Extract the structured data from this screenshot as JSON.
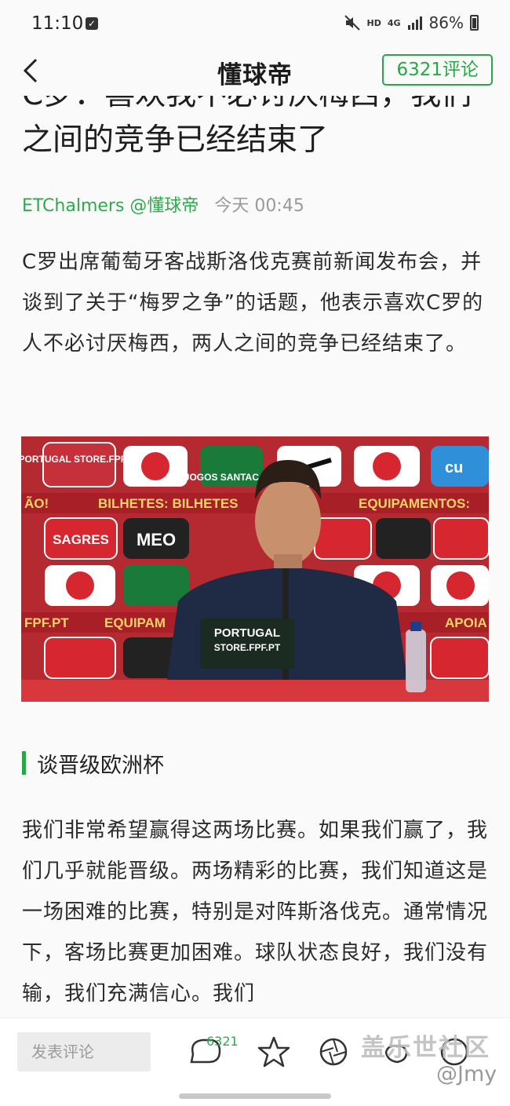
{
  "status_bar": {
    "time": "11:10",
    "network": "HD",
    "network_gen": "4G",
    "battery": "86%"
  },
  "header": {
    "logo": "懂球帝",
    "comment_button": "6321评论"
  },
  "article": {
    "title": "C罗：喜欢我不必讨厌梅西，我们之间的竞争已经结束了",
    "author": "ETChalmers @懂球帝",
    "time": "今天 00:45",
    "intro": "C罗出席葡萄牙客战斯洛伐克赛前新闻发布会，并谈到了关于“梅罗之争”的话题，他表示喜欢C罗的人不必讨厌梅西，两人之间的竞争已经结束了。",
    "photo_texts": {
      "store": "PORTUGAL STORE.FPF.PT",
      "sponsor_a": "SAGRES",
      "sponsor_b": "MEO",
      "sponsor_c": "JOGOS SANTACASA",
      "banner": "BILHETES: BILHETES",
      "banner2": "EQUIPAMENTOS:",
      "banner3": "EQUIPAM",
      "banner4": "APOIA",
      "fpf": "FPF.PT",
      "ao": "ÃO!",
      "cu": "cu"
    },
    "section_title": "谈晋级欧洲杯",
    "body": "我们非常希望赢得这两场比赛。如果我们赢了，我们几乎就能晋级。两场精彩的比赛，我们知道这是一场困难的比赛，特别是对阵斯洛伐克。通常情况下，客场比赛更加困难。球队状态良好，我们没有输，我们充满信心。我们"
  },
  "bottom_bar": {
    "comment_placeholder": "发表评论",
    "comment_count": "6321",
    "watermark": "盖乐世社区",
    "watermark_user": "@Jmy"
  },
  "colors": {
    "accent": "#28a745",
    "author": "#2eaa4d"
  }
}
